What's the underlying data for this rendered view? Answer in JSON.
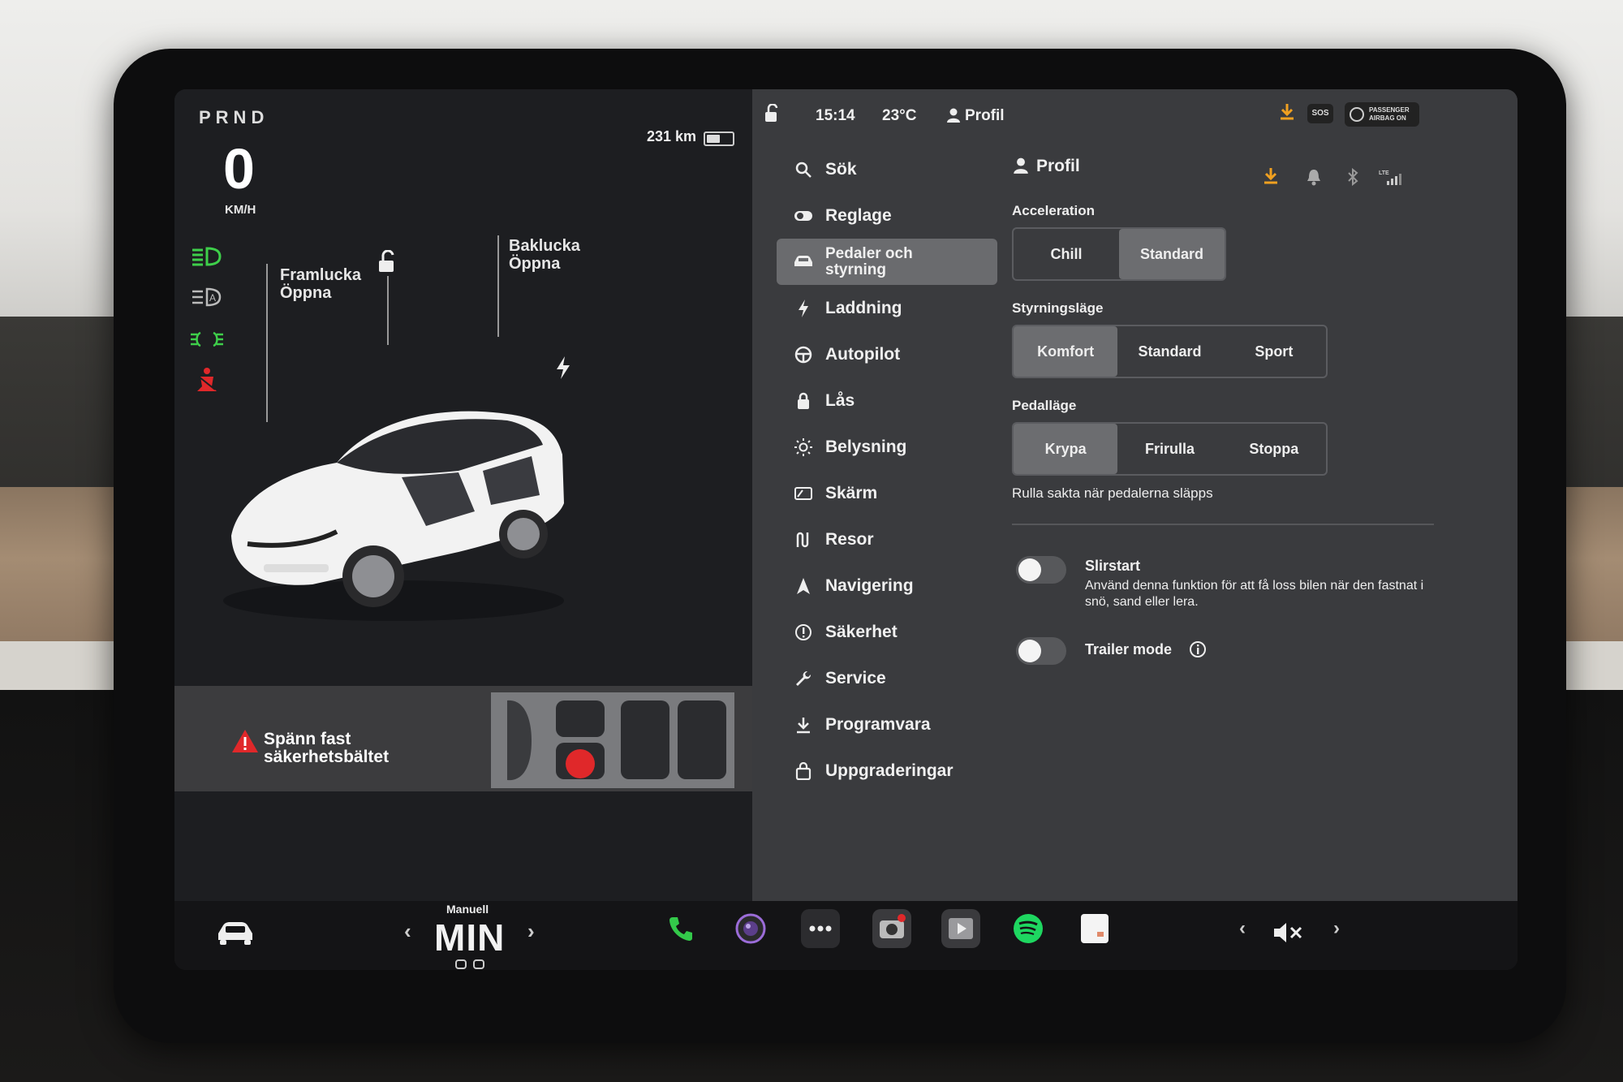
{
  "vehicle": {
    "gear": "PRND",
    "speed": "0",
    "speed_unit": "KM/H",
    "range": "231 km",
    "battery_fraction": 0.6,
    "label_frunk": "Framlucka\nÖppna",
    "label_trunk": "Baklucka\nÖppna",
    "page_dots": 3,
    "active_page": 1
  },
  "alert": {
    "text": "Spänn fast\nsäkerhetsbältet"
  },
  "status_bar": {
    "time": "15:14",
    "temp": "23°C",
    "profile": "Profil",
    "sos": "SOS",
    "airbag": "PASSENGER\nAIRBAG ON"
  },
  "menu": {
    "items": [
      {
        "label": "Sök",
        "icon": "search-icon"
      },
      {
        "label": "Reglage",
        "icon": "toggle-icon"
      },
      {
        "label": "Pedaler och\nstyrning",
        "icon": "car-icon",
        "active": true
      },
      {
        "label": "Laddning",
        "icon": "lightning-icon"
      },
      {
        "label": "Autopilot",
        "icon": "steering-wheel-icon"
      },
      {
        "label": "Lås",
        "icon": "lock-icon"
      },
      {
        "label": "Belysning",
        "icon": "sun-icon"
      },
      {
        "label": "Skärm",
        "icon": "display-icon"
      },
      {
        "label": "Resor",
        "icon": "trips-icon"
      },
      {
        "label": "Navigering",
        "icon": "navigation-arrow-icon"
      },
      {
        "label": "Säkerhet",
        "icon": "info-circle-icon"
      },
      {
        "label": "Service",
        "icon": "wrench-icon"
      },
      {
        "label": "Programvara",
        "icon": "download-icon"
      },
      {
        "label": "Uppgraderingar",
        "icon": "shopping-bag-icon"
      }
    ]
  },
  "content": {
    "title": "Profil",
    "acceleration": {
      "label": "Acceleration",
      "options": [
        "Chill",
        "Standard"
      ],
      "selected": 1
    },
    "steering": {
      "label": "Styrningsläge",
      "options": [
        "Komfort",
        "Standard",
        "Sport"
      ],
      "selected": 0
    },
    "pedal": {
      "label": "Pedalläge",
      "options": [
        "Krypa",
        "Frirulla",
        "Stoppa"
      ],
      "selected": 0,
      "hint": "Rulla sakta när pedalerna släpps"
    },
    "slipstart": {
      "title": "Slirstart",
      "desc": "Använd denna funktion för att få loss bilen när den fastnat i snö, sand eller lera.",
      "on": false
    },
    "trailer": {
      "title": "Trailer mode",
      "on": false
    }
  },
  "bottom_bar": {
    "climate_mode": "Manuell",
    "fan": "MIN"
  },
  "colors": {
    "tell_green": "#3ecf4a",
    "alert_red": "#e0282a",
    "accent_orange": "#f0a020",
    "spotify_green": "#1ed760"
  }
}
